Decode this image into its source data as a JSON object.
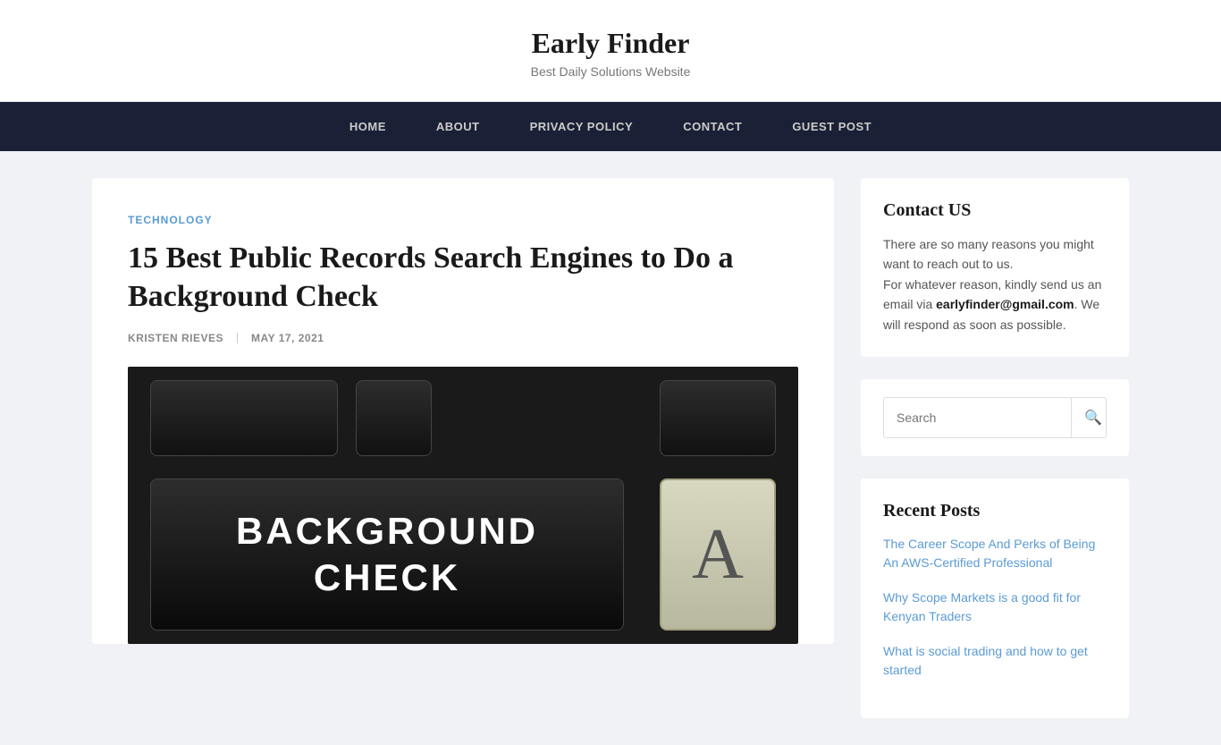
{
  "site": {
    "title": "Early Finder",
    "subtitle": "Best Daily Solutions Website"
  },
  "nav": {
    "items": [
      {
        "label": "HOME",
        "id": "home"
      },
      {
        "label": "ABOUT",
        "id": "about"
      },
      {
        "label": "PRIVACY POLICY",
        "id": "privacy-policy"
      },
      {
        "label": "CONTACT",
        "id": "contact"
      },
      {
        "label": "GUEST POST",
        "id": "guest-post"
      }
    ]
  },
  "post": {
    "category": "TECHNOLOGY",
    "title": "15 Best Public Records Search Engines to Do a Background Check",
    "author": "KRISTEN RIEVES",
    "date": "MAY 17, 2021",
    "image_text_line1": "BACKGROUND",
    "image_text_line2": "CHECK",
    "image_key_letter": "A"
  },
  "sidebar": {
    "contact": {
      "title": "Contact US",
      "text1": "There are so many reasons you might want to reach out to us.",
      "text2": "For whatever reason, kindly send us an email via ",
      "email": "earlyfinder@gmail.com",
      "text3": ". We will respond as soon as possible."
    },
    "search": {
      "placeholder": "Search",
      "button_icon": "🔍"
    },
    "recent_posts": {
      "title": "Recent Posts",
      "items": [
        {
          "label": "The Career Scope And Perks of Being An AWS-Certified Professional"
        },
        {
          "label": "Why Scope Markets is a good fit for Kenyan Traders"
        },
        {
          "label": "What is social trading and how to get started"
        }
      ]
    }
  }
}
